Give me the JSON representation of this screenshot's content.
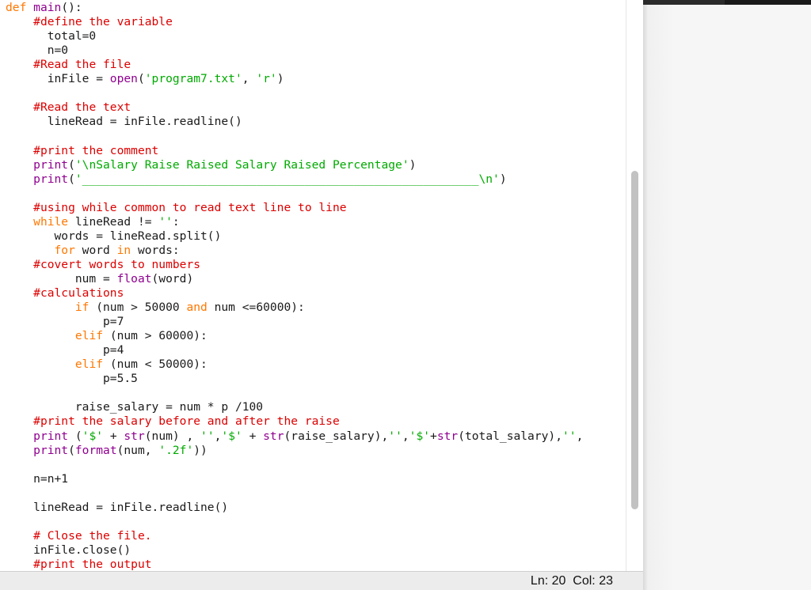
{
  "editor": {
    "lines": [
      {
        "segs": [
          {
            "c": "kw",
            "t": "def "
          },
          {
            "c": "fn",
            "t": "main"
          },
          {
            "c": "tx",
            "t": "():"
          }
        ]
      },
      {
        "segs": [
          {
            "c": "tx",
            "t": "    "
          },
          {
            "c": "cm",
            "t": "#define the variable"
          }
        ]
      },
      {
        "segs": [
          {
            "c": "tx",
            "t": "      total=0"
          }
        ]
      },
      {
        "segs": [
          {
            "c": "tx",
            "t": "      n=0"
          }
        ]
      },
      {
        "segs": [
          {
            "c": "tx",
            "t": "    "
          },
          {
            "c": "cm",
            "t": "#Read the file"
          }
        ]
      },
      {
        "segs": [
          {
            "c": "tx",
            "t": "      inFile = "
          },
          {
            "c": "fn",
            "t": "open"
          },
          {
            "c": "tx",
            "t": "("
          },
          {
            "c": "str",
            "t": "'program7.txt'"
          },
          {
            "c": "tx",
            "t": ", "
          },
          {
            "c": "str",
            "t": "'r'"
          },
          {
            "c": "tx",
            "t": ")"
          }
        ]
      },
      {
        "segs": [
          {
            "c": "tx",
            "t": ""
          }
        ]
      },
      {
        "segs": [
          {
            "c": "tx",
            "t": "    "
          },
          {
            "c": "cm",
            "t": "#Read the text"
          }
        ]
      },
      {
        "segs": [
          {
            "c": "tx",
            "t": "      lineRead = inFile.readline()"
          }
        ]
      },
      {
        "segs": [
          {
            "c": "tx",
            "t": ""
          }
        ]
      },
      {
        "segs": [
          {
            "c": "tx",
            "t": "    "
          },
          {
            "c": "cm",
            "t": "#print the comment"
          }
        ]
      },
      {
        "segs": [
          {
            "c": "tx",
            "t": "    "
          },
          {
            "c": "fn",
            "t": "print"
          },
          {
            "c": "tx",
            "t": "("
          },
          {
            "c": "str",
            "t": "'\\nSalary Raise Raised Salary Raised Percentage'"
          },
          {
            "c": "tx",
            "t": ")"
          }
        ]
      },
      {
        "segs": [
          {
            "c": "tx",
            "t": "    "
          },
          {
            "c": "fn",
            "t": "print"
          },
          {
            "c": "tx",
            "t": "("
          },
          {
            "c": "str",
            "t": "'_________________________________________________________\\n'"
          },
          {
            "c": "tx",
            "t": ")"
          }
        ]
      },
      {
        "segs": [
          {
            "c": "tx",
            "t": ""
          }
        ]
      },
      {
        "segs": [
          {
            "c": "tx",
            "t": "    "
          },
          {
            "c": "cm",
            "t": "#using while common to read text line to line"
          }
        ]
      },
      {
        "segs": [
          {
            "c": "tx",
            "t": "    "
          },
          {
            "c": "kw",
            "t": "while"
          },
          {
            "c": "tx",
            "t": " lineRead != "
          },
          {
            "c": "str",
            "t": "''"
          },
          {
            "c": "tx",
            "t": ":"
          }
        ]
      },
      {
        "segs": [
          {
            "c": "tx",
            "t": "       words = lineRead.split()"
          }
        ]
      },
      {
        "segs": [
          {
            "c": "tx",
            "t": "       "
          },
          {
            "c": "kw",
            "t": "for"
          },
          {
            "c": "tx",
            "t": " word "
          },
          {
            "c": "kw",
            "t": "in"
          },
          {
            "c": "tx",
            "t": " words:"
          }
        ]
      },
      {
        "segs": [
          {
            "c": "tx",
            "t": "    "
          },
          {
            "c": "cm",
            "t": "#covert words to numbers"
          }
        ]
      },
      {
        "segs": [
          {
            "c": "tx",
            "t": "          num = "
          },
          {
            "c": "fn",
            "t": "float"
          },
          {
            "c": "tx",
            "t": "(word)"
          }
        ]
      },
      {
        "segs": [
          {
            "c": "tx",
            "t": "    "
          },
          {
            "c": "cm",
            "t": "#calculations"
          }
        ]
      },
      {
        "segs": [
          {
            "c": "tx",
            "t": "          "
          },
          {
            "c": "kw",
            "t": "if"
          },
          {
            "c": "tx",
            "t": " (num > 50000 "
          },
          {
            "c": "kw",
            "t": "and"
          },
          {
            "c": "tx",
            "t": " num <=60000):"
          }
        ]
      },
      {
        "segs": [
          {
            "c": "tx",
            "t": "              p=7"
          }
        ]
      },
      {
        "segs": [
          {
            "c": "tx",
            "t": "          "
          },
          {
            "c": "kw",
            "t": "elif"
          },
          {
            "c": "tx",
            "t": " (num > 60000):"
          }
        ]
      },
      {
        "segs": [
          {
            "c": "tx",
            "t": "              p=4"
          }
        ]
      },
      {
        "segs": [
          {
            "c": "tx",
            "t": "          "
          },
          {
            "c": "kw",
            "t": "elif"
          },
          {
            "c": "tx",
            "t": " (num < 50000):"
          }
        ]
      },
      {
        "segs": [
          {
            "c": "tx",
            "t": "              p=5.5"
          }
        ]
      },
      {
        "segs": [
          {
            "c": "tx",
            "t": ""
          }
        ]
      },
      {
        "segs": [
          {
            "c": "tx",
            "t": "          raise_salary = num * p /100"
          }
        ]
      },
      {
        "segs": [
          {
            "c": "tx",
            "t": "    "
          },
          {
            "c": "cm",
            "t": "#print the salary before and after the raise"
          }
        ]
      },
      {
        "segs": [
          {
            "c": "tx",
            "t": "    "
          },
          {
            "c": "fn",
            "t": "print"
          },
          {
            "c": "tx",
            "t": " ("
          },
          {
            "c": "str",
            "t": "'$'"
          },
          {
            "c": "tx",
            "t": " + "
          },
          {
            "c": "fn",
            "t": "str"
          },
          {
            "c": "tx",
            "t": "(num) , "
          },
          {
            "c": "str",
            "t": "''"
          },
          {
            "c": "tx",
            "t": ","
          },
          {
            "c": "str",
            "t": "'$'"
          },
          {
            "c": "tx",
            "t": " + "
          },
          {
            "c": "fn",
            "t": "str"
          },
          {
            "c": "tx",
            "t": "(raise_salary),"
          },
          {
            "c": "str",
            "t": "''"
          },
          {
            "c": "tx",
            "t": ","
          },
          {
            "c": "str",
            "t": "'$'"
          },
          {
            "c": "tx",
            "t": "+"
          },
          {
            "c": "fn",
            "t": "str"
          },
          {
            "c": "tx",
            "t": "(total_salary),"
          },
          {
            "c": "str",
            "t": "''"
          },
          {
            "c": "tx",
            "t": ","
          }
        ]
      },
      {
        "segs": [
          {
            "c": "tx",
            "t": "    "
          },
          {
            "c": "fn",
            "t": "print"
          },
          {
            "c": "tx",
            "t": "("
          },
          {
            "c": "fn",
            "t": "format"
          },
          {
            "c": "tx",
            "t": "(num, "
          },
          {
            "c": "str",
            "t": "'.2f'"
          },
          {
            "c": "tx",
            "t": "))"
          }
        ]
      },
      {
        "segs": [
          {
            "c": "tx",
            "t": ""
          }
        ]
      },
      {
        "segs": [
          {
            "c": "tx",
            "t": "    n=n+1"
          }
        ]
      },
      {
        "segs": [
          {
            "c": "tx",
            "t": ""
          }
        ]
      },
      {
        "segs": [
          {
            "c": "tx",
            "t": "    lineRead = inFile.readline()"
          }
        ]
      },
      {
        "segs": [
          {
            "c": "tx",
            "t": ""
          }
        ]
      },
      {
        "segs": [
          {
            "c": "tx",
            "t": "    "
          },
          {
            "c": "cm",
            "t": "# Close the file."
          }
        ]
      },
      {
        "segs": [
          {
            "c": "tx",
            "t": "    inFile.close()"
          }
        ]
      },
      {
        "segs": [
          {
            "c": "tx",
            "t": "    "
          },
          {
            "c": "cm",
            "t": "#print the output"
          }
        ]
      }
    ]
  },
  "status_bar": {
    "position": "Ln: 20  Col: 23"
  },
  "colors": {
    "keyword": "#ff7700",
    "builtin": "#900090",
    "string": "#00aa00",
    "comment": "#dd0000",
    "text": "#1a1a1a"
  }
}
